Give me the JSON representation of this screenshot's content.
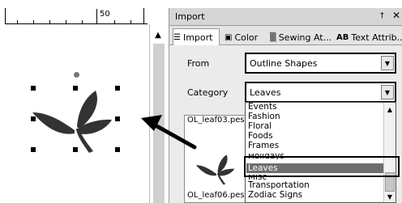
{
  "canvas": {
    "ruler_label": "50"
  },
  "import_panel": {
    "title": "Import",
    "pin_icon": "pin-icon",
    "close_icon": "close-icon",
    "tabs": [
      {
        "label": "Import",
        "icon": "import-icon",
        "active": true
      },
      {
        "label": "Color",
        "icon": "color-icon",
        "active": false
      },
      {
        "label": "Sewing At...",
        "icon": "sewing-icon",
        "active": false
      },
      {
        "label": "Text Attrib...",
        "icon": "text-attrib-icon",
        "icon_text": "AB",
        "active": false
      }
    ],
    "from": {
      "label": "From",
      "value": "Outline Shapes"
    },
    "category": {
      "label": "Category",
      "value": "Leaves"
    },
    "category_options": [
      "Events",
      "Fashion",
      "Floral",
      "Foods",
      "Frames",
      "Holidays",
      "Leaves",
      "Misc",
      "Transportation",
      "Zodiac Signs"
    ],
    "selected_option": "Leaves",
    "preview": {
      "items": [
        "OL_leaf03.pes",
        "OL_leaf06.pes"
      ]
    }
  },
  "colors": {
    "design_fill": "#333333",
    "selected_item_bg": "#6e6e6e",
    "panel_bg": "#ebebeb"
  }
}
